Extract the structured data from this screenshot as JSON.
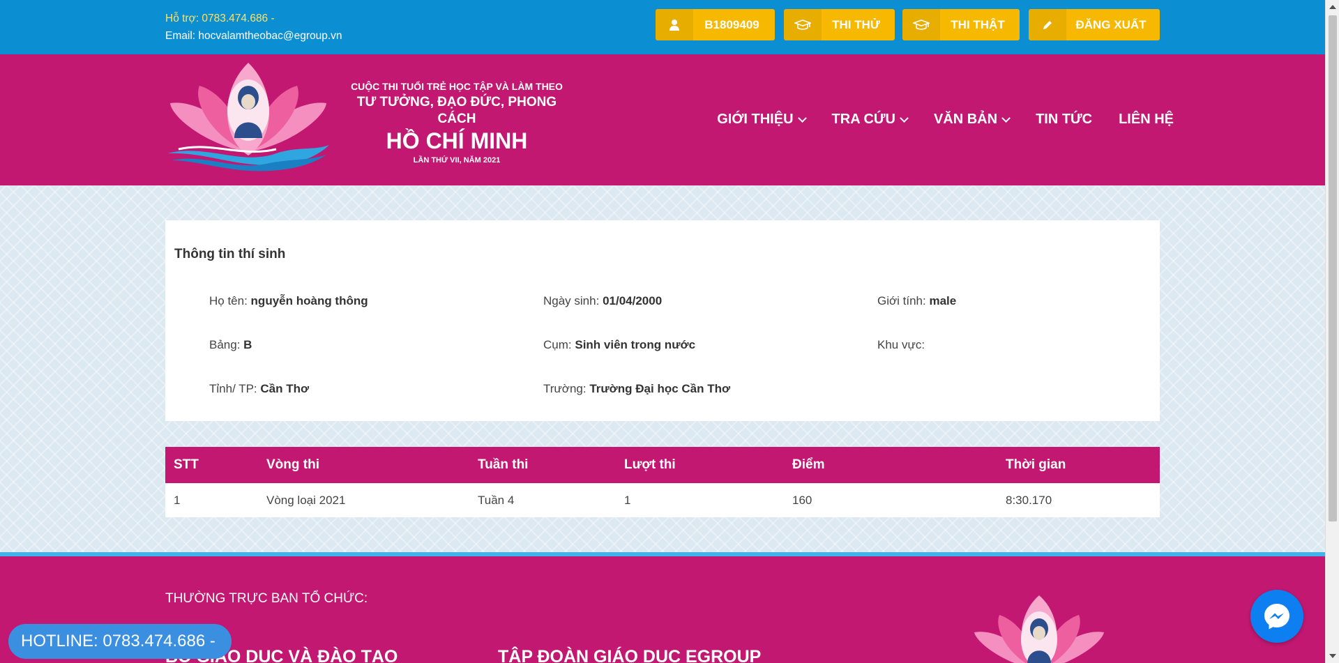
{
  "topbar": {
    "support_label": "Hỗ trợ: 0783.474.686 -",
    "email_label": "Email: hocvalamtheobac@egroup.vn",
    "buttons": {
      "user": "B1809409",
      "practice": "THI THỬ",
      "real": "THI THẬT",
      "logout": "ĐĂNG XUẤT"
    }
  },
  "header": {
    "title_line1": "CUỘC THI TUỔI TRẺ HỌC TẬP VÀ LÀM THEO",
    "title_line2": "TƯ TƯỞNG, ĐẠO ĐỨC, PHONG CÁCH",
    "title_line3": "HỒ CHÍ MINH",
    "title_line4": "LẦN THỨ VII, NĂM 2021"
  },
  "nav": {
    "intro": "GIỚI THIỆU",
    "lookup": "TRA CỨU",
    "docs": "VĂN BẢN",
    "news": "TIN TỨC",
    "contact": "LIÊN HỆ"
  },
  "profile": {
    "heading": "Thông tin thí sinh",
    "name_label": "Họ tên:",
    "name_value": "nguyễn hoàng thông",
    "dob_label": "Ngày sinh:",
    "dob_value": "01/04/2000",
    "gender_label": "Giới tính:",
    "gender_value": "male",
    "board_label": "Bảng:",
    "board_value": "B",
    "cluster_label": "Cụm:",
    "cluster_value": "Sinh viên trong nước",
    "region_label": "Khu vực:",
    "region_value": "",
    "province_label": "Tỉnh/ TP:",
    "province_value": "Cần Thơ",
    "school_label": "Trường:",
    "school_value": "Trường Đại học Cần Thơ"
  },
  "results": {
    "headers": [
      "STT",
      "Vòng thi",
      "Tuần thi",
      "Lượt thi",
      "Điểm",
      "Thời gian"
    ],
    "rows": [
      [
        "1",
        "Vòng loại 2021",
        "Tuần 4",
        "1",
        "160",
        "8:30.170"
      ]
    ]
  },
  "footer": {
    "standing_committee": "THƯỜNG TRỰC BAN TỔ CHỨC:",
    "org1": "BỘ GIÁO DỤC VÀ ĐÀO TẠO",
    "org2": "TẬP ĐOÀN GIÁO DỤC EGROUP"
  },
  "hotline": "HOTLINE: 0783.474.686 -",
  "icons": {
    "user": "user-icon",
    "practice": "graduation-cap-icon",
    "real": "graduation-cap-icon",
    "logout": "pencil-icon",
    "messenger": "messenger-icon"
  },
  "colors": {
    "topbar": "#0b8fd2",
    "header": "#c21871",
    "button": "#f6b800",
    "support_highlight": "#ffe066",
    "hotline": "#3b8fe0"
  }
}
